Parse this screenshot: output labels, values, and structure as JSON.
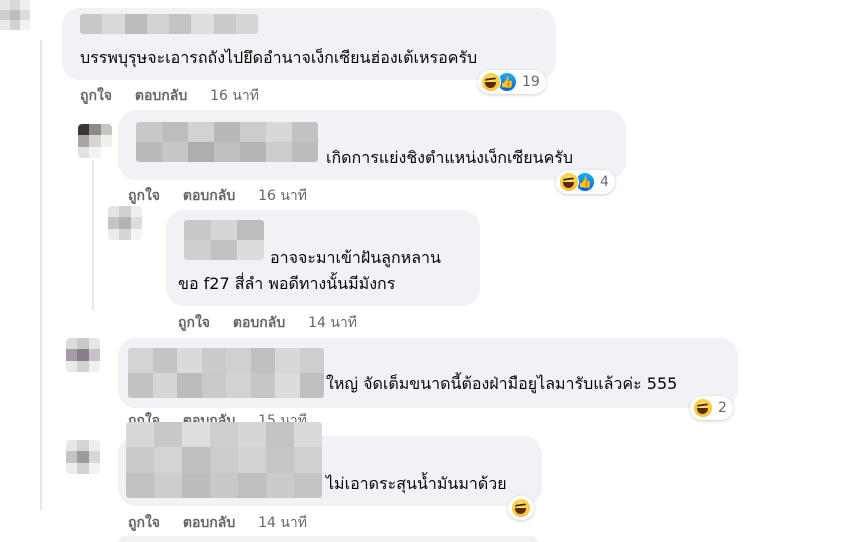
{
  "comments": [
    {
      "text": "บรรพบุรุษจะเอารถถังไปยึดอำนาจเง็กเซียนฮ่องเต้เหรอครับ",
      "reactions": {
        "icons": [
          "haha-icon",
          "like-icon"
        ],
        "count": "19"
      },
      "actions": {
        "like": "ถูกใจ",
        "reply": "ตอบกลับ",
        "time": "16 นาที"
      }
    },
    {
      "text": "เกิดการแย่งชิงตำแหน่งเง็กเซียนครับ",
      "reactions": {
        "icons": [
          "haha-icon",
          "like-icon"
        ],
        "count": "4"
      },
      "actions": {
        "like": "ถูกใจ",
        "reply": "ตอบกลับ",
        "time": "16 นาที"
      }
    },
    {
      "text_line1": "อาจจะมาเข้าฝันลูกหลาน",
      "text_line2": "ขอ f27 สี่ลำ พอดีทางนั้นมีมังกร",
      "actions": {
        "like": "ถูกใจ",
        "reply": "ตอบกลับ",
        "time": "14 นาที"
      }
    },
    {
      "text": "ใหญ่ จัดเต็มขนาดนี้ต้องฝ่ามือยูไลมารับแล้วค่ะ 555",
      "reactions": {
        "icons": [
          "haha-icon"
        ],
        "count": "2"
      },
      "actions": {
        "like": "ถูกใจ",
        "reply": "ตอบกลับ",
        "time": "15 นาที"
      }
    },
    {
      "text": "ไม่เอาดระสุนน้ำมันมาด้วย",
      "reactions": {
        "icons": [
          "haha-icon"
        ],
        "count": ""
      },
      "actions": {
        "like": "ถูกใจ",
        "reply": "ตอบกลับ",
        "time": "14 นาที"
      }
    }
  ],
  "colors": {
    "bubble_bg": "#f0f2f5",
    "action_text": "#65676b",
    "like_blue": "#0866ff",
    "haha_yellow": "#ffc93c"
  }
}
